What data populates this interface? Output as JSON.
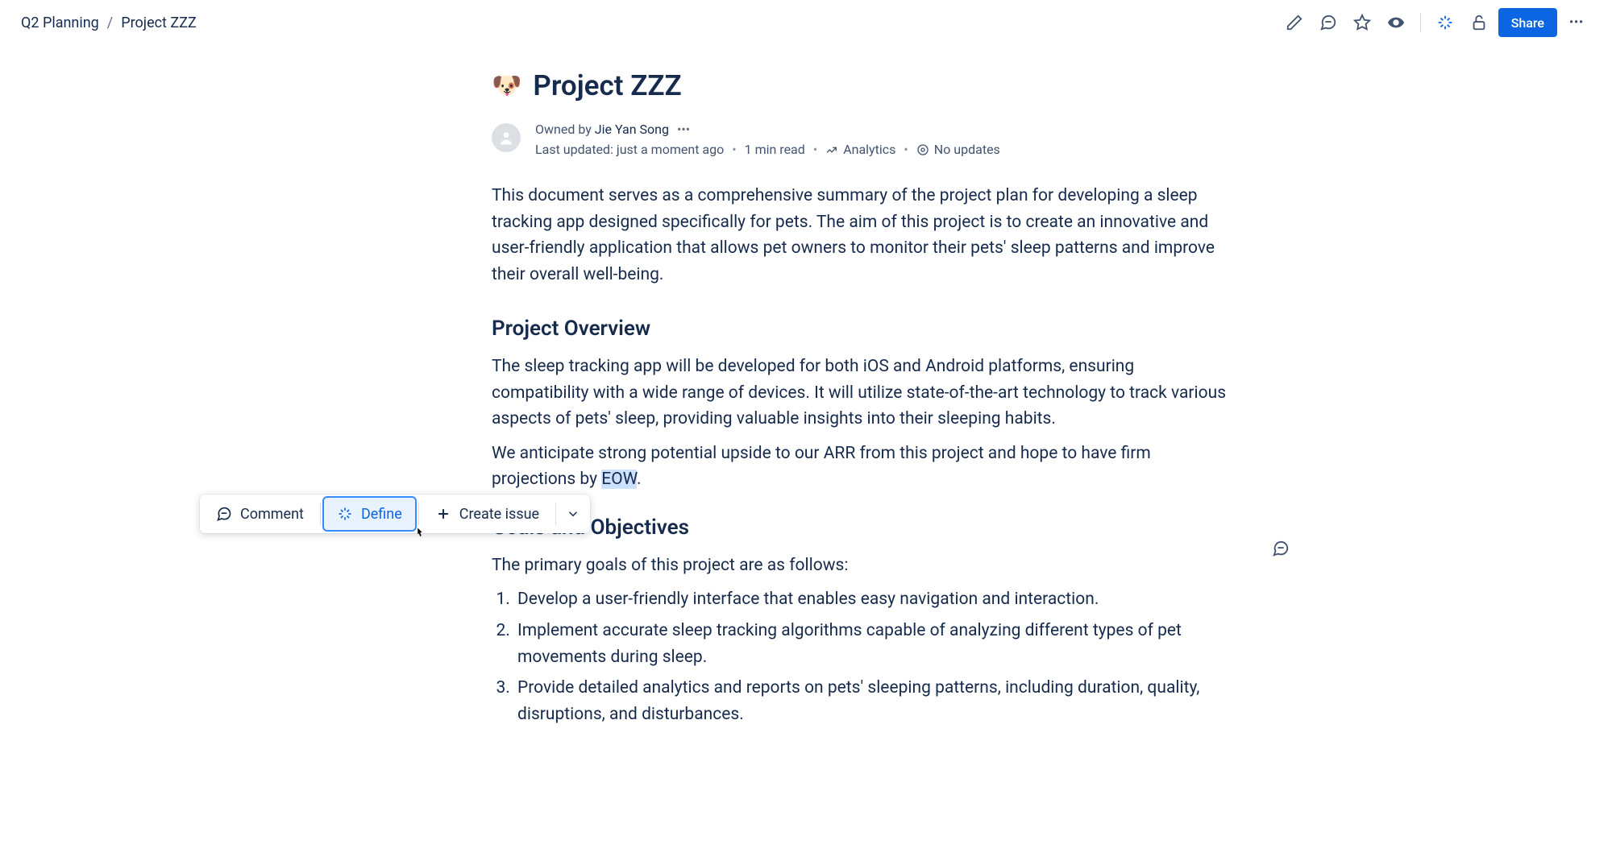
{
  "breadcrumb": {
    "parent": "Q2 Planning",
    "current": "Project ZZZ"
  },
  "header_actions": {
    "share_label": "Share"
  },
  "page": {
    "emoji": "🐶",
    "title": "Project ZZZ"
  },
  "meta": {
    "owned_prefix": "Owned by ",
    "owner": "Jie Yan Song",
    "last_updated": "Last updated: just a moment ago",
    "read_time": "1 min read",
    "analytics_label": "Analytics",
    "updates_label": "No updates"
  },
  "intro_paragraph": "This document serves as a comprehensive summary of the project plan for developing a sleep tracking app designed specifically for pets. The aim of this project is to create an innovative and user-friendly application that allows pet owners to monitor their pets' sleep patterns and improve their overall well-being.",
  "overview": {
    "heading": "Project Overview",
    "para1": "The sleep tracking app will be developed for both iOS and Android platforms, ensuring compatibility with a wide range of devices. It will utilize state-of-the-art technology to track various aspects of pets' sleep, providing valuable insights into their sleeping habits.",
    "para2_pre": "We anticipate strong potential upside to our ARR from this project and hope to have firm projections by ",
    "para2_highlight": "EOW",
    "para2_post": "."
  },
  "goals": {
    "heading": "Goals and Objectives",
    "intro": "The primary goals of this project are as follows:",
    "items": [
      "Develop a user-friendly interface that enables easy navigation and interaction.",
      "Implement accurate sleep tracking algorithms capable of analyzing different types of pet movements during sleep.",
      "Provide detailed analytics and reports on pets' sleeping patterns, including duration, quality, disruptions, and disturbances."
    ]
  },
  "float_toolbar": {
    "comment": "Comment",
    "define": "Define",
    "create_issue": "Create issue"
  }
}
